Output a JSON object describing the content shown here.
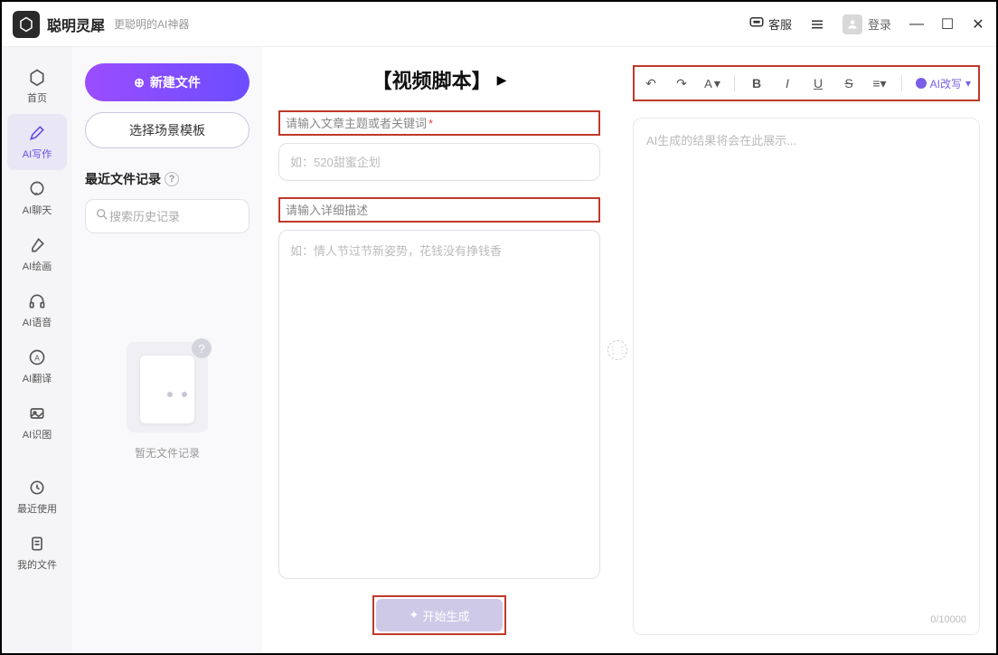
{
  "header": {
    "app_title": "聪明灵犀",
    "app_subtitle": "更聪明的AI神器",
    "customer_service": "客服",
    "login": "登录"
  },
  "sidebar": {
    "items": [
      {
        "label": "首页"
      },
      {
        "label": "AI写作"
      },
      {
        "label": "AI聊天"
      },
      {
        "label": "AI绘画"
      },
      {
        "label": "AI语音"
      },
      {
        "label": "AI翻译"
      },
      {
        "label": "AI识图"
      }
    ],
    "bottom_items": [
      {
        "label": "最近使用"
      },
      {
        "label": "我的文件"
      }
    ]
  },
  "file_panel": {
    "new_file": "新建文件",
    "select_template": "选择场景模板",
    "recent_title": "最近文件记录",
    "search_placeholder": "搜索历史记录",
    "empty_text": "暂无文件记录"
  },
  "main": {
    "page_title": "【视频脚本】",
    "field1_label": "请输入文章主题或者关键词",
    "field1_placeholder": "如：520甜蜜企划",
    "field2_label": "请输入详细描述",
    "field2_placeholder": "如：情人节过节新姿势，花钱没有挣钱香",
    "generate": "开始生成"
  },
  "output": {
    "rewrite": "AI改写",
    "placeholder": "AI生成的结果将会在此展示...",
    "char_count": "0/10000"
  }
}
